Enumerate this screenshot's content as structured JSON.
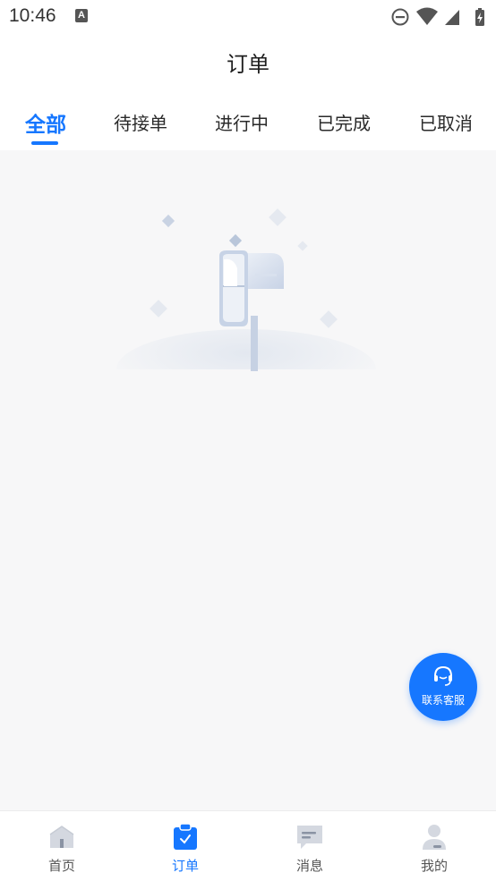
{
  "status_bar": {
    "time": "10:46",
    "notification_icon": "A"
  },
  "header": {
    "title": "订单"
  },
  "tabs": [
    {
      "label": "全部",
      "active": true
    },
    {
      "label": "待接单",
      "active": false
    },
    {
      "label": "进行中",
      "active": false
    },
    {
      "label": "已完成",
      "active": false
    },
    {
      "label": "已取消",
      "active": false
    }
  ],
  "fab": {
    "label": "联系客服",
    "icon": "headset-icon"
  },
  "bottom_nav": [
    {
      "label": "首页",
      "icon": "home-icon",
      "active": false
    },
    {
      "label": "订单",
      "icon": "clipboard-icon",
      "active": true
    },
    {
      "label": "消息",
      "icon": "message-icon",
      "active": false
    },
    {
      "label": "我的",
      "icon": "user-icon",
      "active": false
    }
  ],
  "colors": {
    "accent": "#1677ff",
    "background": "#f7f7f8",
    "inactive_icon": "#d4d8e0"
  }
}
